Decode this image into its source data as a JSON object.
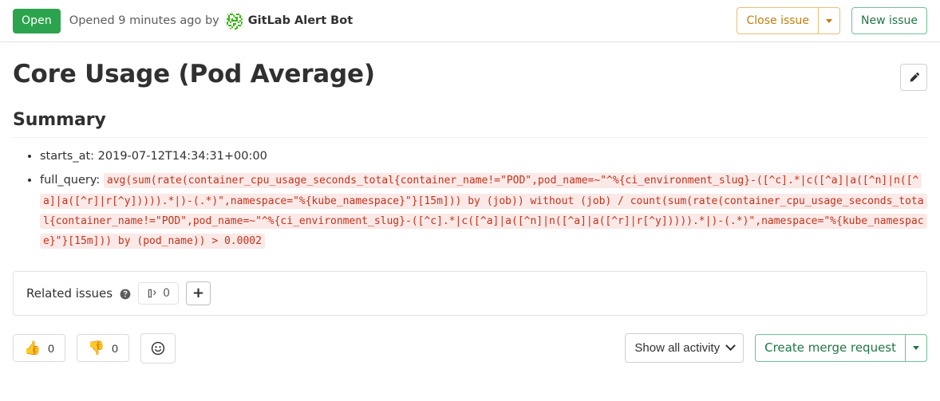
{
  "header": {
    "status_label": "Open",
    "opened_text": "Opened 9 minutes ago by",
    "author": "GitLab Alert Bot",
    "avatar_name": "identicon-avatar",
    "close_issue_label": "Close issue",
    "close_issue_caret_name": "chevron-down-icon",
    "new_issue_label": "New issue",
    "accent_open": "#2ca44e",
    "accent_warning": "#c17d10",
    "accent_success": "#217645"
  },
  "title": {
    "text": "Core Usage (Pod Average)",
    "edit_icon": "pencil-icon"
  },
  "description": {
    "summary_heading": "Summary",
    "items": [
      {
        "label": "starts_at:",
        "value": " 2019-07-12T14:34:31+00:00",
        "code": null
      },
      {
        "label": "full_query:",
        "value": "",
        "code": "avg(sum(rate(container_cpu_usage_seconds_total{container_name!=\"POD\",pod_name=~\"^%{ci_environment_slug}-([^c].*|c([^a]|a([^n]|n([^a]|a([^r]|r[^y])))).*|)-(.*)\",namespace=\"%{kube_namespace}\"}[15m])) by (job)) without (job) / count(sum(rate(container_cpu_usage_seconds_total{container_name!=\"POD\",pod_name=~\"^%{ci_environment_slug}-([^c].*|c([^a]|a([^n]|n([^a]|a([^r]|r[^y])))).*|)-(.*)\",namespace=\"%{kube_namespace}\"}[15m])) by (pod_name)) > 0.0002"
      }
    ]
  },
  "related_issues": {
    "title": "Related issues",
    "help_icon": "question-circle-icon",
    "count_icon": "issue-link-icon",
    "count": "0",
    "add_label": "+"
  },
  "footer": {
    "thumbs_up_emoji": "👍",
    "thumbs_up_count": "0",
    "thumbs_down_emoji": "👎",
    "thumbs_down_count": "0",
    "emoji_picker_icon": "smiley-icon",
    "activity_filter_label": "Show all activity",
    "activity_caret_name": "chevron-down-icon",
    "create_mr_label": "Create merge request",
    "create_mr_caret_name": "chevron-down-icon"
  }
}
